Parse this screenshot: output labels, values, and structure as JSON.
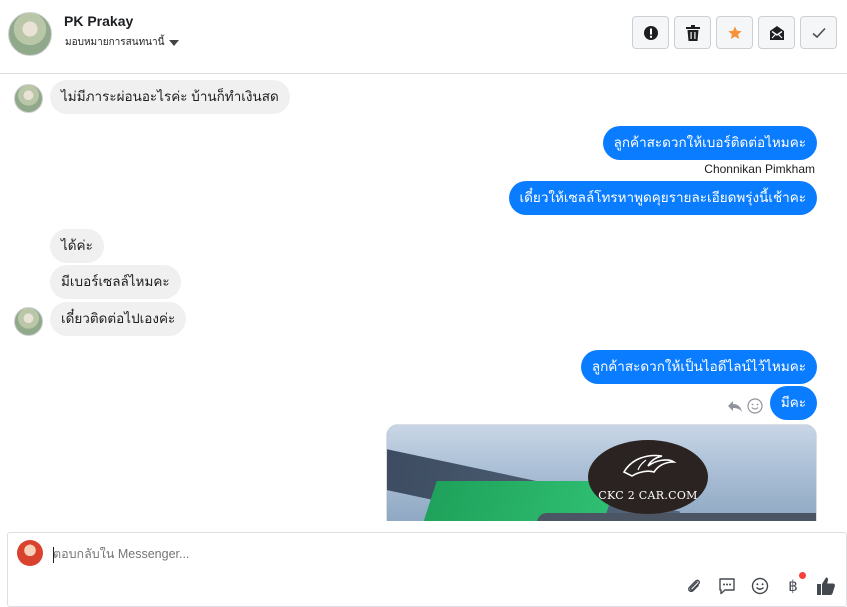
{
  "header": {
    "contact_name": "PK Prakay",
    "assign_label": "มอบหมายการสนทนานี้",
    "actions": [
      {
        "name": "mark-spam-button",
        "icon": "exclamation-icon"
      },
      {
        "name": "delete-button",
        "icon": "trash-icon"
      },
      {
        "name": "star-button",
        "icon": "star-icon"
      },
      {
        "name": "mark-unread-button",
        "icon": "envelope-icon"
      },
      {
        "name": "mark-done-button",
        "icon": "check-icon"
      }
    ]
  },
  "messages": [
    {
      "dir": "in",
      "text": "ไม่มีภาระผ่อนอะไรค่ะ บ้านก็ทำเงินสด"
    },
    {
      "dir": "out",
      "text": "ลูกค้าสะดวกให้เบอร์ติดต่อไหมคะ"
    },
    {
      "dir": "meta",
      "text": "Chonnikan Pimkham"
    },
    {
      "dir": "out",
      "text": "เดี๋ยวให้เซลล์โทรหาพูดคุยรายละเอียดพรุ่งนี้เช้าคะ"
    },
    {
      "dir": "in",
      "text": "ได้ค่ะ"
    },
    {
      "dir": "in",
      "text": "มีเบอร์เซลล์ไหมคะ"
    },
    {
      "dir": "in",
      "text": "เดี๋ยวติดต่อไปเองค่ะ"
    },
    {
      "dir": "out",
      "text": "ลูกค้าสะดวกให้เป็นไอดีไลน์ไว้ไหมคะ"
    },
    {
      "dir": "out",
      "text": "มีคะ"
    }
  ],
  "image_logo_text": "CKC 2 CAR.COM",
  "composer": {
    "placeholder": "ตอบกลับใน Messenger...",
    "baht_symbol": "฿"
  },
  "colors": {
    "outgoing_bubble": "#0a7cff",
    "incoming_bubble": "#f1f0f0",
    "star": "#f7923b",
    "notification_dot": "#fa3e3e"
  }
}
